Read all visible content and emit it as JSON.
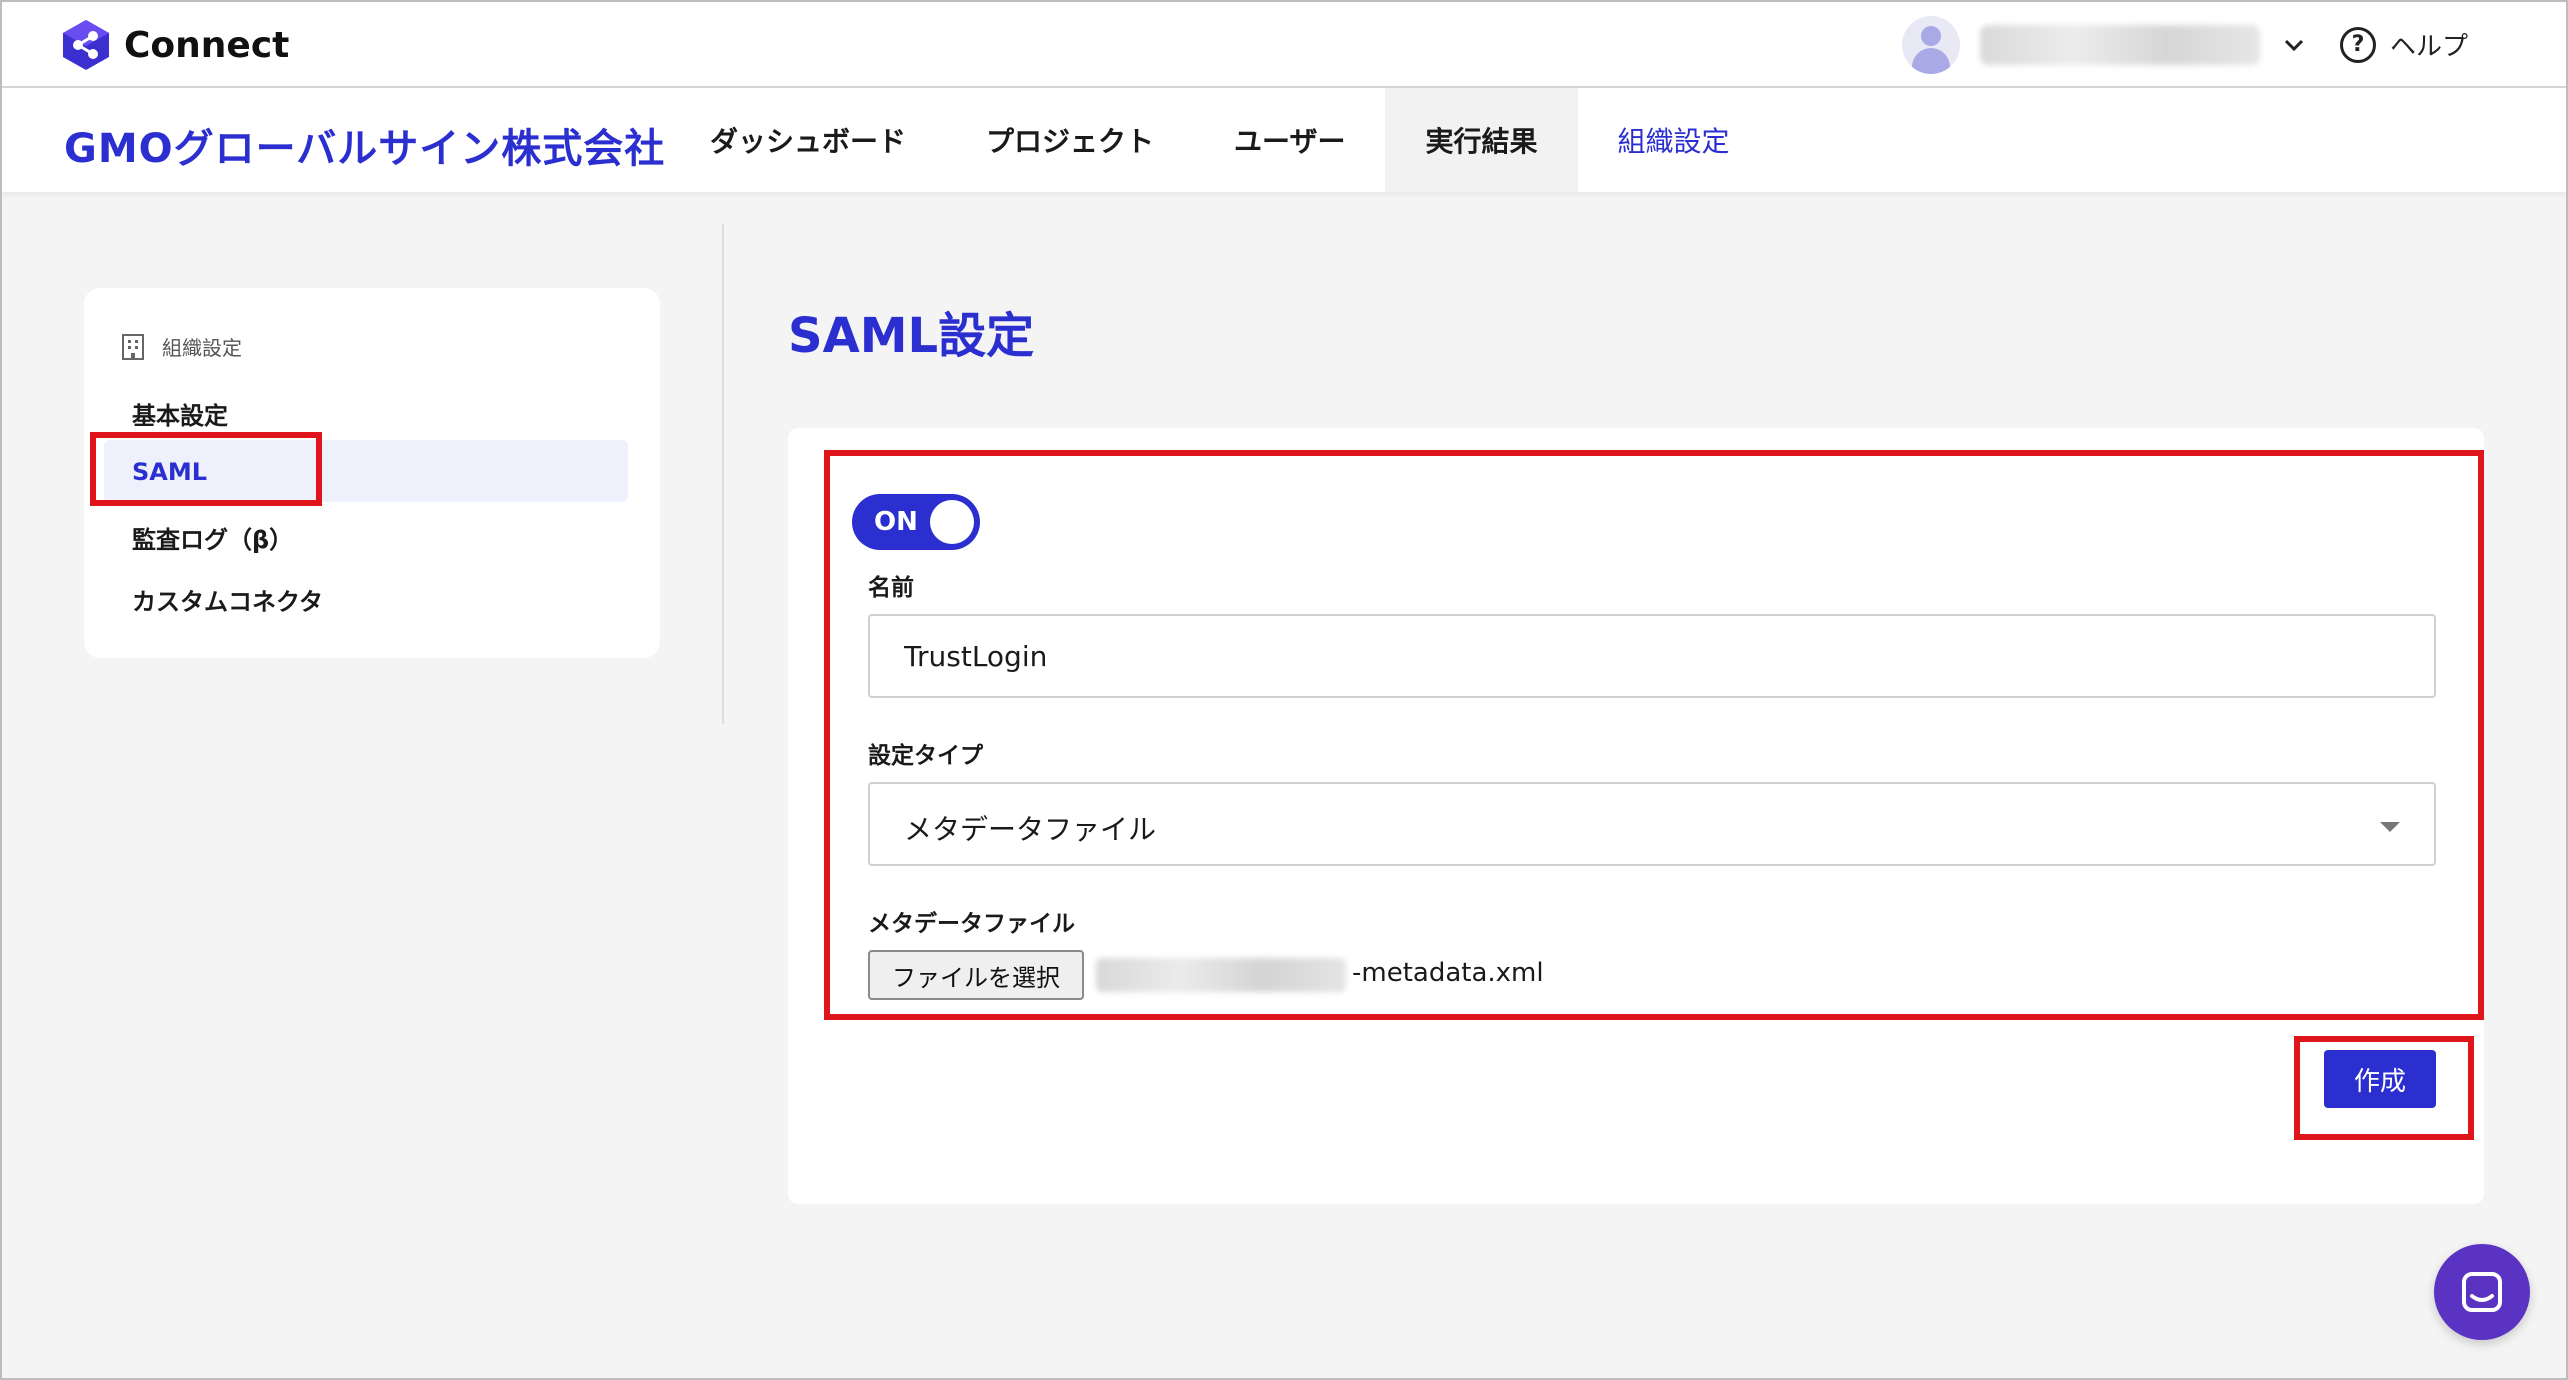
{
  "app": {
    "logo_text": "Connect",
    "help_label": "ヘルプ"
  },
  "nav": {
    "org_name": "GMOグローバルサイン株式会社",
    "tabs": [
      {
        "label": "ダッシュボード"
      },
      {
        "label": "プロジェクト"
      },
      {
        "label": "ユーザー"
      },
      {
        "label": "実行結果"
      },
      {
        "label": "組織設定"
      }
    ]
  },
  "sidebar": {
    "heading": "組織設定",
    "items": [
      {
        "label": "基本設定"
      },
      {
        "label": "SAML"
      },
      {
        "label": "監査ログ（β）"
      },
      {
        "label": "カスタムコネクタ"
      }
    ]
  },
  "main": {
    "title": "SAML設定",
    "toggle_label": "ON",
    "toggle_state": "on",
    "name_label": "名前",
    "name_value": "TrustLogin",
    "type_label": "設定タイプ",
    "type_value": "メタデータファイル",
    "file_label": "メタデータファイル",
    "file_button": "ファイルを選択",
    "file_name_suffix": "-metadata.xml",
    "create_button": "作成"
  },
  "colors": {
    "accent": "#2b2fcf",
    "annotation": "#e0151b",
    "chat": "#5b33c2"
  }
}
